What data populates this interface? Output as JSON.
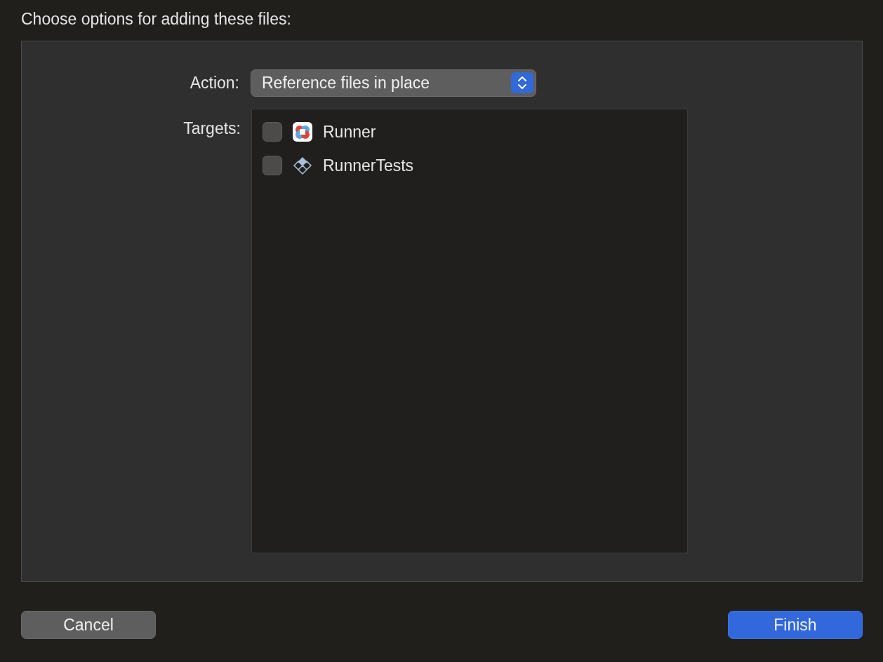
{
  "heading": "Choose options for adding these files:",
  "action": {
    "label": "Action:",
    "value": "Reference files in place"
  },
  "targets": {
    "label": "Targets:",
    "items": [
      {
        "name": "Runner",
        "kind": "app",
        "checked": false
      },
      {
        "name": "RunnerTests",
        "kind": "test",
        "checked": false
      }
    ]
  },
  "buttons": [
    {
      "label": "Cancel",
      "kind": "secondary"
    },
    {
      "label": "Finish",
      "kind": "primary"
    }
  ]
}
